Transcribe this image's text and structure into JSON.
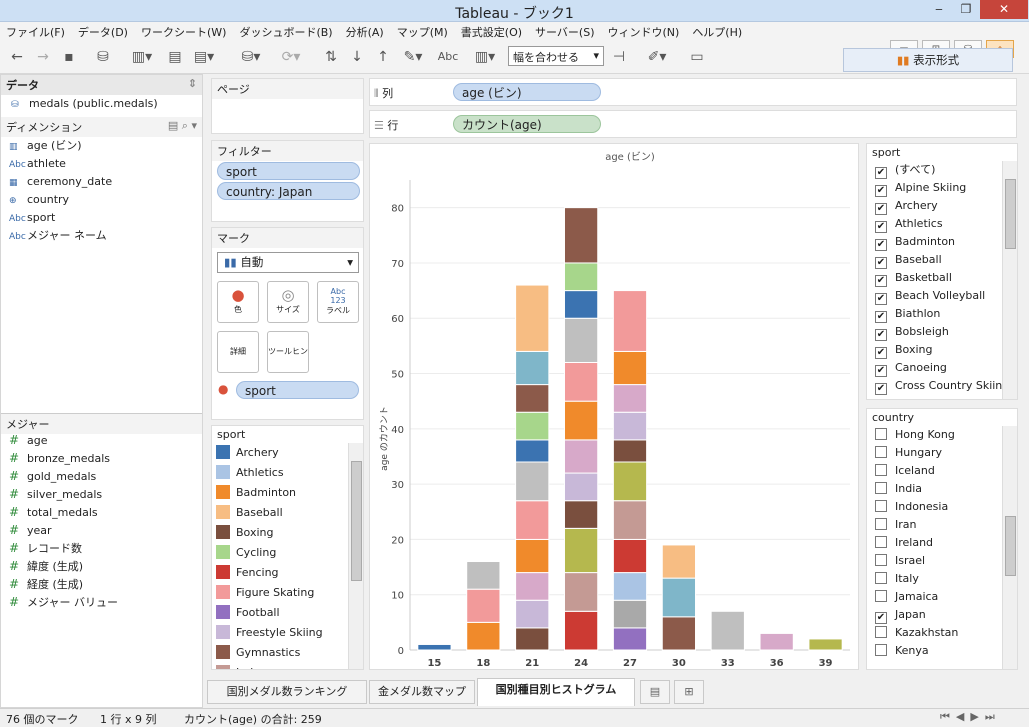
{
  "window": {
    "title": "Tableau - ブック1"
  },
  "menu": [
    "ファイル(F)",
    "データ(D)",
    "ワークシート(W)",
    "ダッシュボード(B)",
    "分析(A)",
    "マップ(M)",
    "書式設定(O)",
    "サーバー(S)",
    "ウィンドウ(N)",
    "ヘルプ(H)"
  ],
  "toolbar": {
    "fit": "幅を合わせる",
    "abc": "Abc"
  },
  "showme": "表示形式",
  "data_pane": {
    "title": "データ",
    "source": "medals (public.medals)",
    "dim_title": "ディメンション",
    "dimensions": [
      {
        "icon": "bin-icon",
        "name": "age (ビン)"
      },
      {
        "icon": "abc-icon",
        "name": "athlete"
      },
      {
        "icon": "date-icon",
        "name": "ceremony_date"
      },
      {
        "icon": "globe-icon",
        "name": "country"
      },
      {
        "icon": "abc-icon",
        "name": "sport"
      },
      {
        "icon": "abc-icon",
        "name": "メジャー ネーム"
      }
    ],
    "meas_title": "メジャー",
    "measures": [
      "age",
      "bronze_medals",
      "gold_medals",
      "silver_medals",
      "total_medals",
      "year",
      "レコード数",
      "緯度 (生成)",
      "経度 (生成)",
      "メジャー バリュー"
    ]
  },
  "pages_title": "ページ",
  "filters": {
    "title": "フィルター",
    "pills": [
      "sport",
      "country: Japan"
    ]
  },
  "marks": {
    "title": "マーク",
    "type": "自動",
    "buttons": [
      "色",
      "サイズ",
      "ラベル",
      "詳細",
      "ツールヒント"
    ],
    "color_pill": "sport"
  },
  "columns": {
    "label": "列",
    "pill": "age (ビン)"
  },
  "rows": {
    "label": "行",
    "pill": "カウント(age)"
  },
  "legend": {
    "title": "sport",
    "items": [
      {
        "name": "Archery",
        "color": "#3b73b1"
      },
      {
        "name": "Athletics",
        "color": "#aac4e4"
      },
      {
        "name": "Badminton",
        "color": "#f08a2b"
      },
      {
        "name": "Baseball",
        "color": "#f7bd83"
      },
      {
        "name": "Boxing",
        "color": "#7a4f3e"
      },
      {
        "name": "Cycling",
        "color": "#a7d68b"
      },
      {
        "name": "Fencing",
        "color": "#cc3a33"
      },
      {
        "name": "Figure Skating",
        "color": "#f29a9a"
      },
      {
        "name": "Football",
        "color": "#9270c0"
      },
      {
        "name": "Freestyle Skiing",
        "color": "#c8b8d8"
      },
      {
        "name": "Gymnastics",
        "color": "#8c5a4a"
      },
      {
        "name": "Judo",
        "color": "#c49a94"
      }
    ]
  },
  "sport_filter": {
    "title": "sport",
    "items": [
      {
        "label": "(すべて)",
        "checked": true
      },
      {
        "label": "Alpine Skiing",
        "checked": true
      },
      {
        "label": "Archery",
        "checked": true
      },
      {
        "label": "Athletics",
        "checked": true
      },
      {
        "label": "Badminton",
        "checked": true
      },
      {
        "label": "Baseball",
        "checked": true
      },
      {
        "label": "Basketball",
        "checked": true
      },
      {
        "label": "Beach Volleyball",
        "checked": true
      },
      {
        "label": "Biathlon",
        "checked": true
      },
      {
        "label": "Bobsleigh",
        "checked": true
      },
      {
        "label": "Boxing",
        "checked": true
      },
      {
        "label": "Canoeing",
        "checked": true
      },
      {
        "label": "Cross Country Skiing",
        "checked": true
      }
    ]
  },
  "country_filter": {
    "title": "country",
    "items": [
      {
        "label": "Hong Kong",
        "checked": false
      },
      {
        "label": "Hungary",
        "checked": false
      },
      {
        "label": "Iceland",
        "checked": false
      },
      {
        "label": "India",
        "checked": false
      },
      {
        "label": "Indonesia",
        "checked": false
      },
      {
        "label": "Iran",
        "checked": false
      },
      {
        "label": "Ireland",
        "checked": false
      },
      {
        "label": "Israel",
        "checked": false
      },
      {
        "label": "Italy",
        "checked": false
      },
      {
        "label": "Jamaica",
        "checked": false
      },
      {
        "label": "Japan",
        "checked": true
      },
      {
        "label": "Kazakhstan",
        "checked": false
      },
      {
        "label": "Kenya",
        "checked": false
      }
    ]
  },
  "chart_data": {
    "type": "bar",
    "title": "age (ビン)",
    "ylabel": "age のカウント",
    "categories": [
      "15",
      "18",
      "21",
      "24",
      "27",
      "30",
      "33",
      "36",
      "39"
    ],
    "values": [
      1,
      16,
      66,
      80,
      65,
      19,
      7,
      3,
      2
    ],
    "ylim": [
      0,
      85
    ],
    "yticks": [
      0,
      10,
      20,
      30,
      40,
      50,
      60,
      70,
      80
    ],
    "stacked": true,
    "grid": true
  },
  "tabs": [
    "国別メダル数ランキング",
    "金メダル数マップ",
    "国別種目別ヒストグラム"
  ],
  "status": {
    "marks": "76 個のマーク",
    "dims": "1 行 x 9 列",
    "sum": "カウント(age) の合計: 259"
  }
}
